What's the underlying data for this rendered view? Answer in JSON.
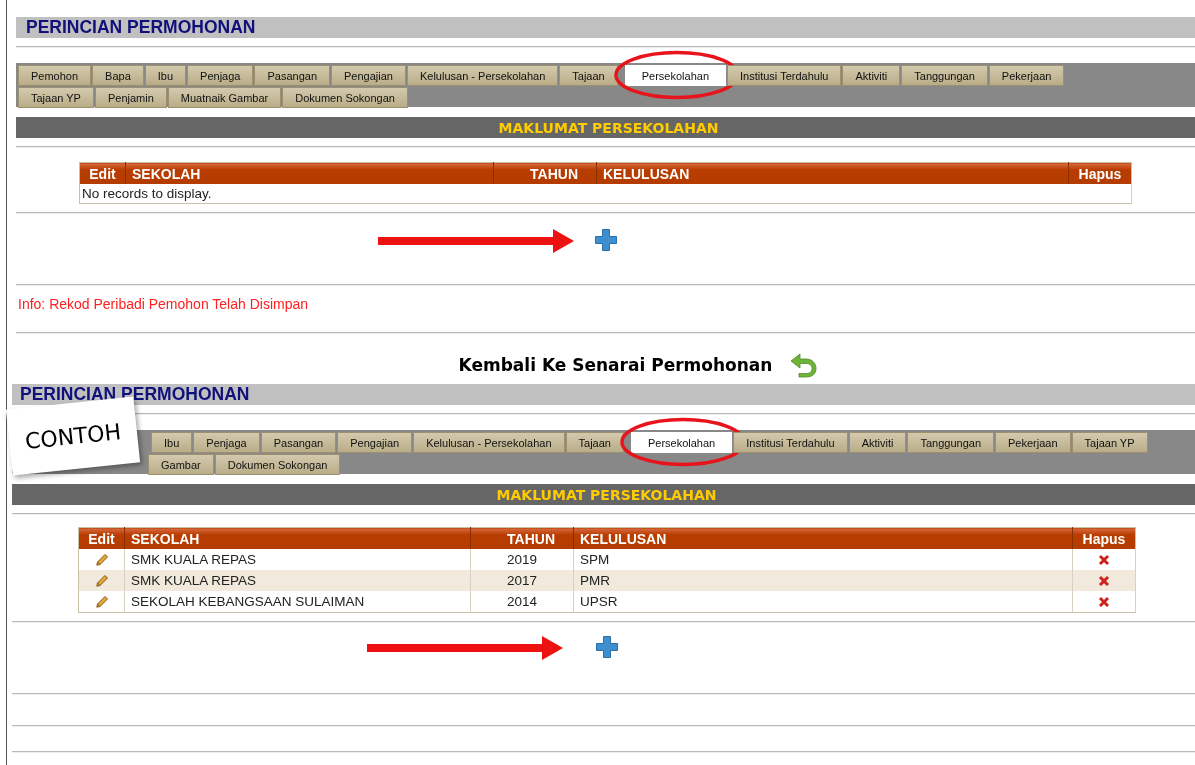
{
  "panels": [
    {
      "title": "PERINCIAN PERMOHONAN",
      "tab_rows": [
        {
          "tabs": [
            {
              "label": "Pemohon",
              "selected": false
            },
            {
              "label": "Bapa",
              "selected": false
            },
            {
              "label": "Ibu",
              "selected": false
            },
            {
              "label": "Penjaga",
              "selected": false
            },
            {
              "label": "Pasangan",
              "selected": false
            },
            {
              "label": "Pengajian",
              "selected": false
            },
            {
              "label": "Kelulusan - Persekolahan",
              "selected": false
            },
            {
              "label": "Tajaan",
              "selected": false
            },
            {
              "label": "Persekolahan",
              "selected": true
            },
            {
              "label": "Institusi Terdahulu",
              "selected": false
            },
            {
              "label": "Aktiviti",
              "selected": false
            },
            {
              "label": "Tanggungan",
              "selected": false
            },
            {
              "label": "Pekerjaan",
              "selected": false
            }
          ]
        },
        {
          "tabs": [
            {
              "label": "Tajaan YP",
              "selected": false
            },
            {
              "label": "Penjamin",
              "selected": false
            },
            {
              "label": "Muatnaik Gambar",
              "selected": false
            },
            {
              "label": "Dokumen Sokongan",
              "selected": false
            }
          ]
        }
      ],
      "section_title": "MAKLUMAT PERSEKOLAHAN",
      "table": {
        "columns": [
          "Edit",
          "SEKOLAH",
          "TAHUN",
          "KELULUSAN",
          "Hapus"
        ],
        "empty_message": "No records to display."
      },
      "info": "Info: Rekod Peribadi Pemohon Telah Disimpan",
      "back_link": "Kembali Ke Senarai Permohonan"
    },
    {
      "title": "PERINCIAN PERMOHONAN",
      "sticker": "CONTOH",
      "tab_rows": [
        {
          "tabs": [
            {
              "label": "Ibu",
              "selected": false
            },
            {
              "label": "Penjaga",
              "selected": false
            },
            {
              "label": "Pasangan",
              "selected": false
            },
            {
              "label": "Pengajian",
              "selected": false
            },
            {
              "label": "Kelulusan - Persekolahan",
              "selected": false
            },
            {
              "label": "Tajaan",
              "selected": false
            },
            {
              "label": "Persekolahan",
              "selected": true
            },
            {
              "label": "Institusi Terdahulu",
              "selected": false
            },
            {
              "label": "Aktiviti",
              "selected": false
            },
            {
              "label": "Tanggungan",
              "selected": false
            },
            {
              "label": "Pekerjaan",
              "selected": false
            },
            {
              "label": "Tajaan YP",
              "selected": false
            }
          ]
        },
        {
          "tabs": [
            {
              "label": "Gambar",
              "selected": false
            },
            {
              "label": "Dokumen Sokongan",
              "selected": false
            }
          ]
        }
      ],
      "section_title": "MAKLUMAT PERSEKOLAHAN",
      "table": {
        "columns": [
          "Edit",
          "SEKOLAH",
          "TAHUN",
          "KELULUSAN",
          "Hapus"
        ],
        "rows": [
          {
            "school": "SMK KUALA REPAS",
            "year": "2019",
            "result": "SPM"
          },
          {
            "school": "SMK KUALA REPAS",
            "year": "2017",
            "result": "PMR"
          },
          {
            "school": "SEKOLAH KEBANGSAAN SULAIMAN",
            "year": "2014",
            "result": "UPSR"
          }
        ]
      }
    }
  ]
}
